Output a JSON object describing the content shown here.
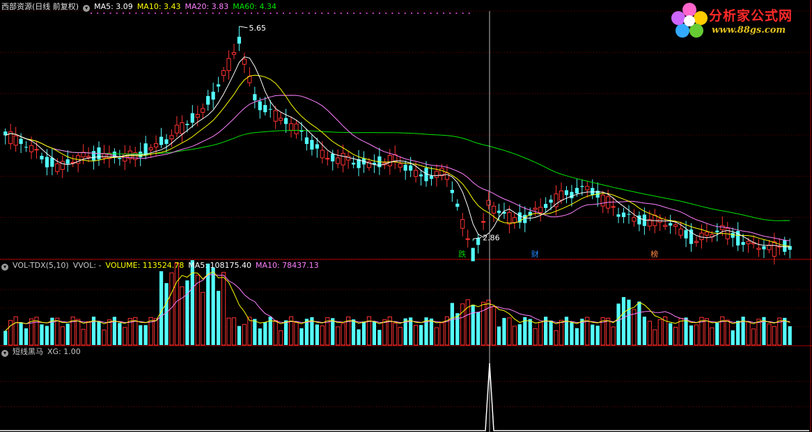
{
  "header": {
    "stock_title": "西部资源(日线 前复权)",
    "ma5": "MA5: 3.09",
    "ma10": "MA10: 3.43",
    "ma20": "MA20: 3.83",
    "ma60": "MA60: 4.34"
  },
  "volume_panel": {
    "title": "VOL-TDX(5,10)",
    "vvol": "VVOL: -",
    "volume": "VOLUME: 113524.78",
    "ma5": "MA5: 108175.40",
    "ma10": "MA10: 78437.13"
  },
  "signal_panel": {
    "title": "短线黑马",
    "xg": "XG: 1.00"
  },
  "logo": {
    "main": "分析家公式网",
    "url": "www.88gs.com"
  },
  "colors": {
    "up": "#ff3232",
    "down": "#54fcfc",
    "ma5": "#ffffff",
    "ma10": "#ffff00",
    "ma20": "#ff80ff",
    "ma60": "#00e600",
    "grid": "#8b0000",
    "panel_border": "#aa0000"
  },
  "chart_data": [
    {
      "type": "candlestick",
      "series": [
        {
          "name": "MA5"
        },
        {
          "name": "MA10"
        },
        {
          "name": "MA20"
        },
        {
          "name": "MA60"
        }
      ],
      "ylim": [
        2.6,
        5.85
      ],
      "annotations": [
        {
          "text": "5.65",
          "x": 45,
          "y": 5.65
        },
        {
          "text": "2.86",
          "x": 112,
          "y": 2.86
        }
      ],
      "markers": [
        {
          "text": "跌",
          "x": 108
        },
        {
          "text": "财",
          "x": 122
        },
        {
          "text": "榜",
          "x": 145
        }
      ],
      "crosshair_x": 115
    },
    {
      "type": "bar",
      "series": [
        {
          "name": "VOLUME"
        },
        {
          "name": "MA5"
        },
        {
          "name": "MA10"
        }
      ]
    },
    {
      "type": "line",
      "series": [
        {
          "name": "XG"
        }
      ],
      "spike_x": 115,
      "spike_value": 1.0
    }
  ]
}
